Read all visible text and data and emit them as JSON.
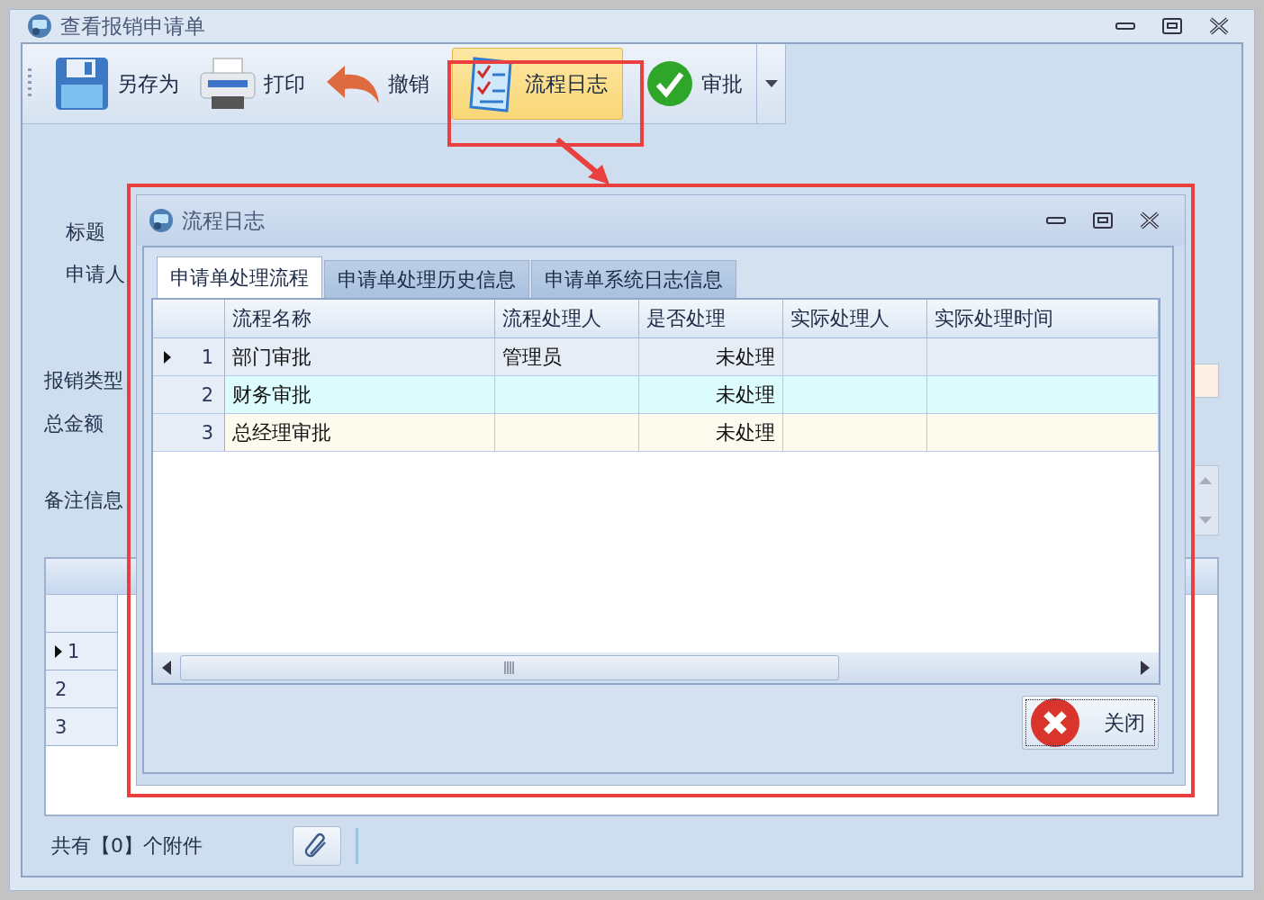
{
  "window": {
    "title": "查看报销申请单"
  },
  "toolbar": {
    "buttons": [
      {
        "label": "另存为",
        "kind": "save",
        "selected": false
      },
      {
        "label": "打印",
        "kind": "print",
        "selected": false
      },
      {
        "label": "撤销",
        "kind": "undo",
        "selected": false
      },
      {
        "label": "流程日志",
        "kind": "log",
        "selected": true
      },
      {
        "label": "审批",
        "kind": "approve",
        "selected": false
      }
    ]
  },
  "form": {
    "labels": [
      "标题",
      "申请人",
      "报销类型",
      "总金额",
      "备注信息"
    ]
  },
  "background_grid": {
    "rows": [
      {
        "number": "1",
        "selected": true
      },
      {
        "number": "2",
        "selected": false
      },
      {
        "number": "3",
        "selected": false
      }
    ]
  },
  "attachments": {
    "summary": "共有【0】个附件"
  },
  "dialog": {
    "title": "流程日志",
    "tabs": [
      {
        "label": "申请单处理流程",
        "selected": true
      },
      {
        "label": "申请单处理历史信息",
        "selected": false
      },
      {
        "label": "申请单系统日志信息",
        "selected": false
      }
    ],
    "table": {
      "columns": [
        "流程名称",
        "流程处理人",
        "是否处理",
        "实际处理人",
        "实际处理时间"
      ],
      "rows": [
        {
          "number": "1",
          "selected": true,
          "color": "#e6edf7",
          "name": "部门审批",
          "handler": "管理员",
          "status": "未处理"
        },
        {
          "number": "2",
          "selected": false,
          "color": "#dcfcfe",
          "name": "财务审批",
          "status": "未处理"
        },
        {
          "number": "3",
          "selected": false,
          "color": "#fdfaee",
          "name": "总经理审批",
          "status": "未处理"
        }
      ]
    },
    "close_button": "关闭"
  }
}
